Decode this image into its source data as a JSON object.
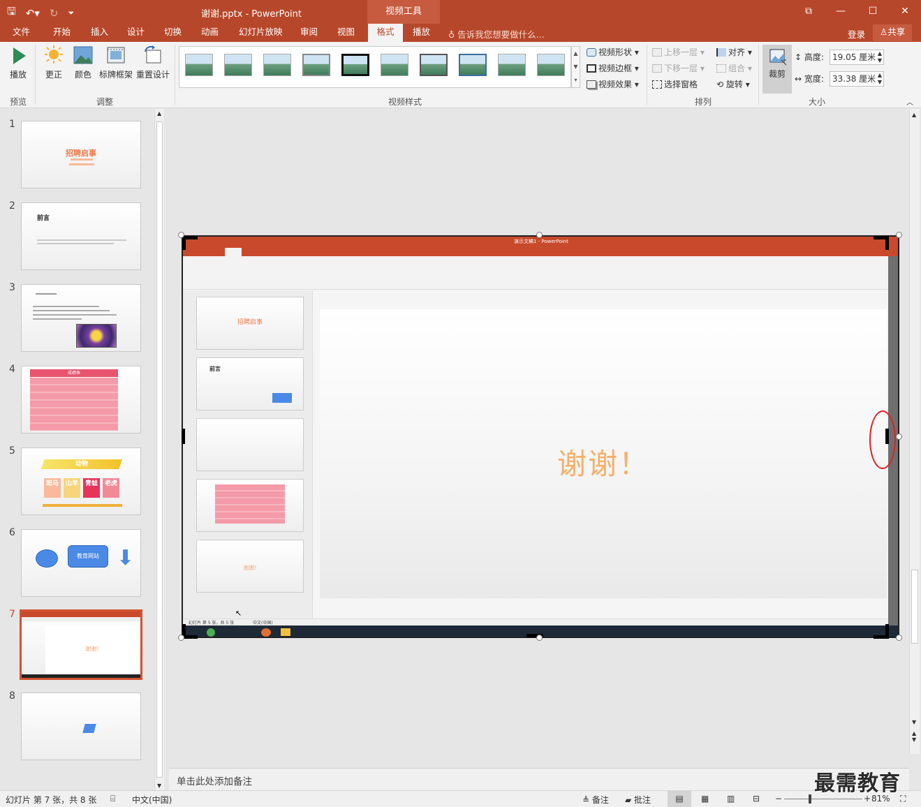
{
  "titlebar": {
    "doc_title": "谢谢.pptx - PowerPoint",
    "context_tab": "视频工具"
  },
  "menu": {
    "tabs": [
      "文件",
      "开始",
      "插入",
      "设计",
      "切换",
      "动画",
      "幻灯片放映",
      "审阅",
      "视图",
      "格式",
      "播放"
    ],
    "active": "格式",
    "tell_me": "告诉我您想要做什么...",
    "login": "登录",
    "share": "共享"
  },
  "ribbon": {
    "play_label": "播放",
    "correct_label": "更正",
    "color_label": "颜色",
    "poster_label": "标牌框架",
    "reset_label": "重置设计",
    "video_shape": "视频形状",
    "video_border": "视频边框",
    "video_effects": "视频效果",
    "bring_forward": "上移一层",
    "send_backward": "下移一层",
    "selection_pane": "选择窗格",
    "align": "对齐",
    "group": "组合",
    "rotate": "旋转",
    "crop": "裁剪",
    "height_label": "高度:",
    "height_value": "19.05 厘米",
    "width_label": "宽度:",
    "width_value": "33.38 厘米",
    "group_labels": {
      "preview": "预览",
      "adjust": "调整",
      "video_styles": "视频样式",
      "arrange": "排列",
      "size": "大小"
    }
  },
  "slides": {
    "numbers": [
      "1",
      "2",
      "3",
      "4",
      "5",
      "6",
      "7",
      "8"
    ],
    "s1_title": "招聘启事",
    "s2_title": "前言",
    "s4_title": "成绩表",
    "s5_title": "动物",
    "s5_cells": [
      "斑马",
      "山羊",
      "青蛙",
      "老虎"
    ],
    "s6_label": "教育网站",
    "s7_text": "谢谢!"
  },
  "video_screen": {
    "title": "演示文稿1 - PowerPoint",
    "main_text": "谢谢！",
    "inner_thumb1_title": "招聘启事",
    "inner_thumb2_title": "前言",
    "inner_thumb5_text": "谢谢!",
    "status_left": "幻灯片 第 5 张，共 5 张",
    "status_lang": "中文(中国)"
  },
  "notes": {
    "placeholder": "单击此处添加备注"
  },
  "status": {
    "slide_info": "幻灯片 第 7 张，共 8 张",
    "language": "中文(中国)",
    "notes_btn": "备注",
    "comments_btn": "批注",
    "zoom": "81%"
  },
  "watermark": "最需教育",
  "colors": {
    "accent": "#b7472a",
    "selection": "#d35230",
    "highlight_circle": "#e02020"
  }
}
